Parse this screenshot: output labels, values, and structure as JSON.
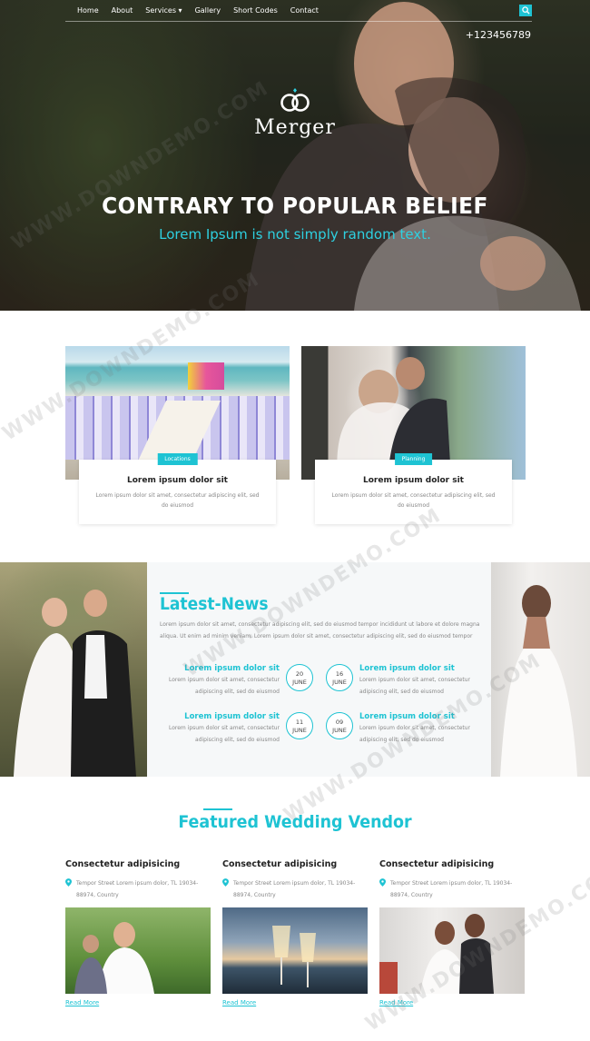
{
  "nav": {
    "items": [
      "Home",
      "About",
      "Services ▾",
      "Gallery",
      "Short Codes",
      "Contact"
    ],
    "search_icon": "search-icon"
  },
  "hero": {
    "phone": "+123456789",
    "logo_text": "Merger",
    "logo_icon": "rings-icon",
    "title": "CONTRARY TO POPULAR BELIEF",
    "subtitle": "Lorem Ipsum is not simply random text."
  },
  "cards": [
    {
      "tag": "Locations",
      "title": "Lorem ipsum dolor sit",
      "text": "Lorem ipsum dolor sit amet, consectetur adipiscing elit, sed do eiusmod"
    },
    {
      "tag": "Planning",
      "title": "Lorem ipsum dolor sit",
      "text": "Lorem ipsum dolor sit amet, consectetur adipiscing elit, sed do eiusmod"
    }
  ],
  "news": {
    "title": "Latest-News",
    "intro": "Lorem ipsum dolor sit amet, consectetur adipiscing elit, sed do eiusmod tempor incididunt ut labore et dolore magna aliqua. Ut enim ad minim veniam. Lorem ipsum dolor sit amet, consectetur adipiscing elit, sed do eiusmod tempor",
    "events": [
      {
        "title": "Lorem ipsum dolor sit",
        "text": "Lorem ipsum dolor sit amet, consectetur adipiscing elit, sed do eiusmod",
        "day": "20",
        "month": "JUNE"
      },
      {
        "title": "Lorem ipsum dolor sit",
        "text": "Lorem ipsum dolor sit amet, consectetur adipiscing elit, sed do eiusmod",
        "day": "16",
        "month": "JUNE"
      },
      {
        "title": "Lorem ipsum dolor sit",
        "text": "Lorem ipsum dolor sit amet, consectetur adipiscing elit, sed do eiusmod",
        "day": "11",
        "month": "JUNE"
      },
      {
        "title": "Lorem ipsum dolor sit",
        "text": "Lorem ipsum dolor sit amet, consectetur adipiscing elit, sed do eiusmod",
        "day": "09",
        "month": "JUNE"
      }
    ]
  },
  "vendors": {
    "heading": "Featured Wedding Vendor",
    "items": [
      {
        "title": "Consectetur adipisicing",
        "address": "Tempor Street Lorem ipsum dolor, TL 19034-88974, Country",
        "link": "Read More"
      },
      {
        "title": "Consectetur adipisicing",
        "address": "Tempor Street Lorem ipsum dolor, TL 19034-88974, Country",
        "link": "Read More"
      },
      {
        "title": "Consectetur adipisicing",
        "address": "Tempor Street Lorem ipsum dolor, TL 19034-88974, Country",
        "link": "Read More"
      }
    ],
    "pin_icon": "map-pin-icon"
  },
  "watermark": "WWW.DOWNDEMO.COM",
  "colors": {
    "accent": "#1ec3d3",
    "text_dark": "#222222",
    "text_muted": "#888888"
  }
}
